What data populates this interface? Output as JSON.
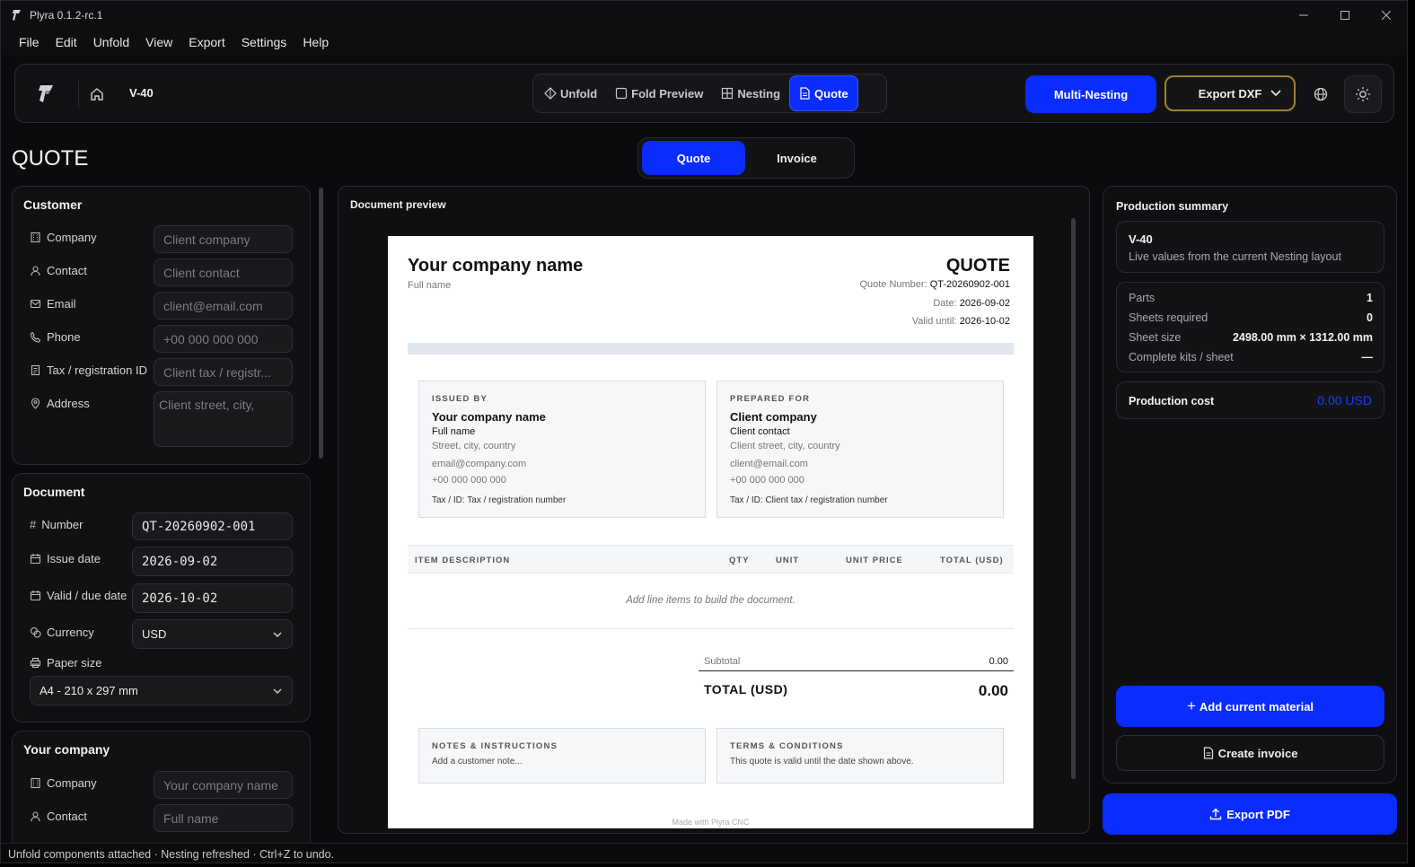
{
  "window": {
    "title": "Plyra 0.1.2-rc.1"
  },
  "menu": [
    "File",
    "Edit",
    "Unfold",
    "View",
    "Export",
    "Settings",
    "Help"
  ],
  "toolbar": {
    "project": "V-40",
    "tabs": [
      "Unfold",
      "Fold Preview",
      "Nesting",
      "Quote"
    ],
    "active_tab": "Quote",
    "multi_nesting": "Multi-Nesting",
    "export_dxf": "Export DXF"
  },
  "page": {
    "title": "QUOTE",
    "segments": [
      "Quote",
      "Invoice"
    ],
    "active_segment": "Quote"
  },
  "customer": {
    "heading": "Customer",
    "fields": [
      {
        "label": "Company",
        "placeholder": "Client company"
      },
      {
        "label": "Contact",
        "placeholder": "Client contact"
      },
      {
        "label": "Email",
        "placeholder": "client@email.com"
      },
      {
        "label": "Phone",
        "placeholder": "+00 000 000 000"
      },
      {
        "label": "Tax / registration ID",
        "placeholder": "Client tax / registr..."
      },
      {
        "label": "Address",
        "placeholder": "Client street, city,"
      }
    ]
  },
  "document": {
    "heading": "Document",
    "number_label": "Number",
    "number": "QT-20260902-001",
    "issue_label": "Issue date",
    "issue": "2026-09-02",
    "due_label": "Valid / due date",
    "due": "2026-10-02",
    "currency_label": "Currency",
    "currency": "USD",
    "paper_label": "Paper size",
    "paper": "A4 - 210 x 297 mm"
  },
  "company": {
    "heading": "Your company",
    "fields": [
      {
        "label": "Company",
        "placeholder": "Your company name"
      },
      {
        "label": "Contact",
        "placeholder": "Full name"
      }
    ]
  },
  "preview": {
    "label": "Document preview",
    "company_name": "Your company name",
    "full_name": "Full name",
    "doc_title": "QUOTE",
    "quote_number_label": "Quote Number:",
    "quote_number": "QT-20260902-001",
    "date_label": "Date:",
    "date": "2026-09-02",
    "valid_label": "Valid until:",
    "valid": "2026-10-02",
    "issued_by": {
      "caps": "ISSUED BY",
      "name": "Your company name",
      "contact": "Full name",
      "address": "Street, city, country",
      "email": "email@company.com",
      "phone": "+00 000 000 000",
      "tax": "Tax / ID: Tax / registration number"
    },
    "prepared_for": {
      "caps": "PREPARED FOR",
      "name": "Client company",
      "contact": "Client contact",
      "address": "Client street, city, country",
      "email": "client@email.com",
      "phone": "+00 000 000 000",
      "tax": "Tax / ID: Client tax / registration number"
    },
    "columns": [
      "ITEM DESCRIPTION",
      "QTY",
      "UNIT",
      "UNIT PRICE",
      "TOTAL (USD)"
    ],
    "empty": "Add line items to build the document.",
    "subtotal_label": "Subtotal",
    "subtotal": "0.00",
    "total_label": "TOTAL (USD)",
    "total": "0.00",
    "notes_caps": "NOTES & INSTRUCTIONS",
    "notes": "Add a customer note...",
    "terms_caps": "TERMS & CONDITIONS",
    "terms": "This quote is valid until the date shown above.",
    "footer": "Made with Plyra CNC"
  },
  "summary": {
    "heading": "Production summary",
    "name": "V-40",
    "sub": "Live values from the current Nesting layout",
    "rows": [
      {
        "label": "Parts",
        "value": "1"
      },
      {
        "label": "Sheets required",
        "value": "0"
      },
      {
        "label": "Sheet size",
        "value": "2498.00 mm × 1312.00 mm"
      },
      {
        "label": "Complete kits / sheet",
        "value": "—"
      }
    ],
    "cost_label": "Production cost",
    "cost": "0.00 USD",
    "add_material": "Add current material",
    "create_invoice": "Create invoice",
    "export_pdf": "Export PDF"
  },
  "status": "Unfold components attached · Nesting refreshed · Ctrl+Z to undo.",
  "colors": {
    "accent": "#0a2cff",
    "gold": "#a08038"
  }
}
